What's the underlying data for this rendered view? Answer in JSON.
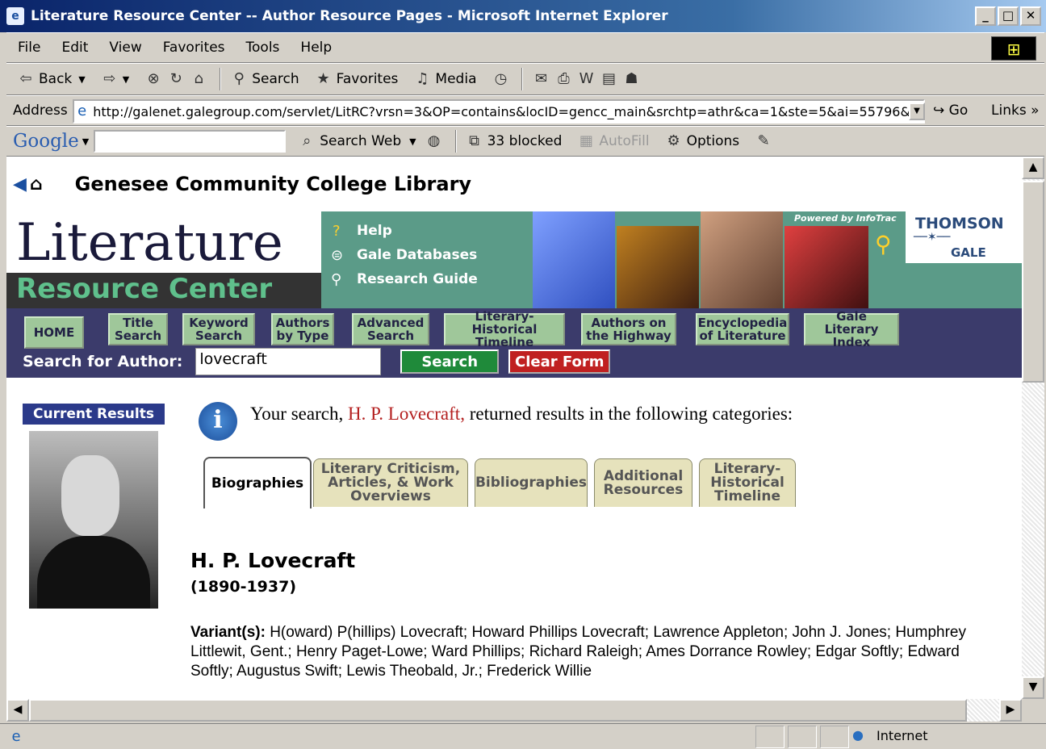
{
  "window": {
    "title": "Literature Resource Center -- Author Resource Pages - Microsoft Internet Explorer",
    "min": "_",
    "max": "□",
    "close": "✕"
  },
  "menu": [
    "File",
    "Edit",
    "View",
    "Favorites",
    "Tools",
    "Help"
  ],
  "toolbar": {
    "back": "Back",
    "search": "Search",
    "favorites": "Favorites",
    "media": "Media"
  },
  "address": {
    "label": "Address",
    "url": "http://galenet.galegroup.com/servlet/LitRC?vrsn=3&OP=contains&locID=gencc_main&srchtp=athr&ca=1&ste=5&ai=55796&ta",
    "go": "Go",
    "links": "Links"
  },
  "googlebar": {
    "logo": "Google",
    "search_web": "Search Web",
    "blocked": "33 blocked",
    "autofill": "AutoFill",
    "options": "Options"
  },
  "page": {
    "library": "Genesee Community College Library",
    "logo_line1": "Literature",
    "logo_line2": "Resource Center",
    "help_links": [
      "Help",
      "Gale Databases",
      "Research Guide"
    ],
    "powered": "Powered by InfoTrac",
    "thomson": "THOMSON",
    "gale": "GALE",
    "nav": [
      "HOME",
      "Title Search",
      "Keyword Search",
      "Authors by Type",
      "Advanced Search",
      "Literary-Historical Timeline",
      "Authors on the Highway",
      "Encyclopedia of Literature",
      "Gale Literary Index"
    ],
    "search_label": "Search for Author:",
    "search_value": "lovecraft",
    "search_btn": "Search",
    "clear_btn": "Clear Form",
    "current_results": "Current Results",
    "intro_pre": "Your search, ",
    "intro_hl": "H. P. Lovecraft,",
    "intro_post": " returned results in the following categories:",
    "tabs": [
      "Biographies",
      "Literary Criticism, Articles, & Work Overviews",
      "Bibliographies",
      "Additional Resources",
      "Literary-Historical Timeline"
    ],
    "author_name": "H. P. Lovecraft",
    "author_dates": "(1890-1937)",
    "variants_label": "Variant(s):",
    "variants_text": " H(oward) P(hillips) Lovecraft; Howard Phillips Lovecraft; Lawrence Appleton; John J. Jones; Humphrey Littlewit, Gent.; Henry Paget-Lowe; Ward Phillips; Richard Raleigh; Ames Dorrance Rowley; Edgar Softly; Edward Softly; Augustus Swift; Lewis Theobald, Jr.; Frederick Willie"
  },
  "status": {
    "zone": "Internet"
  },
  "colors": {
    "banner": "#5b9b88",
    "nav": "#3b3b6b",
    "search_btn": "#1f8a3a",
    "clear_btn": "#c02020",
    "highlight": "#b42020"
  }
}
